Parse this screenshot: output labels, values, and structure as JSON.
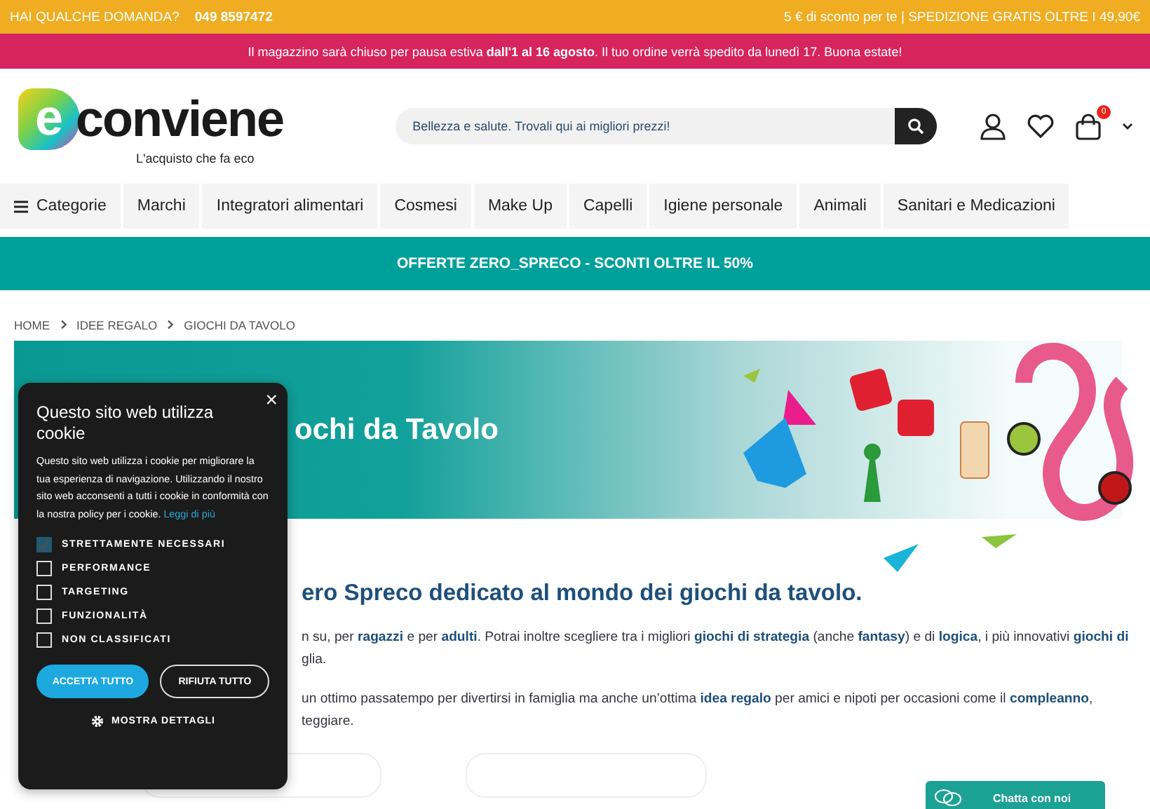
{
  "top_bar": {
    "question": "HAI QUALCHE DOMANDA?",
    "phone": "049 8597472",
    "promo": "5 € di sconto per te | SPEDIZIONE GRATIS OLTRE I 49,90€"
  },
  "notice": "Il magazzino sarà chiuso per pausa estiva **dall'1 al 16 agosto**. Il tuo ordine verrà spedito da lunedì 17. Buona estate!",
  "logo": {
    "mark": "e",
    "name": "conviene",
    "tagline": "L'acquisto che fa eco"
  },
  "search": {
    "placeholder": "Bellezza e salute. Trovali qui ai migliori prezzi!"
  },
  "cart": {
    "count": "0"
  },
  "nav": [
    {
      "label": "Categorie",
      "kind": "menu"
    },
    {
      "label": "Marchi",
      "kind": "link"
    },
    {
      "label": "Integratori alimentari",
      "kind": "link"
    },
    {
      "label": "Cosmesi",
      "kind": "link"
    },
    {
      "label": "Make Up",
      "kind": "link"
    },
    {
      "label": "Capelli",
      "kind": "link"
    },
    {
      "label": "Igiene personale",
      "kind": "link"
    },
    {
      "label": "Animali",
      "kind": "link"
    },
    {
      "label": "Sanitari e Medicazioni",
      "kind": "link"
    }
  ],
  "offer_banner": "OFFERTE ZERO_SPRECO - SCONTI OLTRE IL 50%",
  "breadcrumb": [
    "HOME",
    "IDEE REGALO",
    "GIOCHI DA TAVOLO"
  ],
  "hero": {
    "title": "ochi da Tavolo"
  },
  "heading": "ero Spreco dedicato al mondo dei giochi da tavolo.",
  "paragraph_lines": [
    "n su, per **ragazzi** e per **adulti**. Potrai inoltre scegliere tra i migliori **giochi di strategia** (anche **fantasy**) e di **logica**, i più innovativi **giochi di**",
    "glia.",
    "un ottimo passatempo per divertirsi in famiglia ma anche un’ottima **idea regalo** per amici e nipoti per occasioni come il **compleanno**,",
    "teggiare."
  ],
  "cookie": {
    "title": "Questo sito web utilizza cookie",
    "body": "Questo sito web utilizza i cookie per migliorare la tua esperienza di navigazione. Utilizzando il nostro sito web acconsenti a tutti i cookie in conformità con la nostra policy per i cookie.",
    "link": "Leggi di più",
    "options": [
      {
        "label": "STRETTAMENTE NECESSARI",
        "checked": true,
        "disabled": true
      },
      {
        "label": "PERFORMANCE",
        "checked": false,
        "disabled": false
      },
      {
        "label": "TARGETING",
        "checked": false,
        "disabled": false
      },
      {
        "label": "FUNZIONALITÀ",
        "checked": false,
        "disabled": false
      },
      {
        "label": "NON CLASSIFICATI",
        "checked": false,
        "disabled": false
      }
    ],
    "accept": "ACCETTA TUTTO",
    "reject": "RIFIUTA TUTTO",
    "details": "MOSTRA DETTAGLI",
    "close": "×"
  },
  "chat": {
    "label": "Chatta con noi"
  }
}
